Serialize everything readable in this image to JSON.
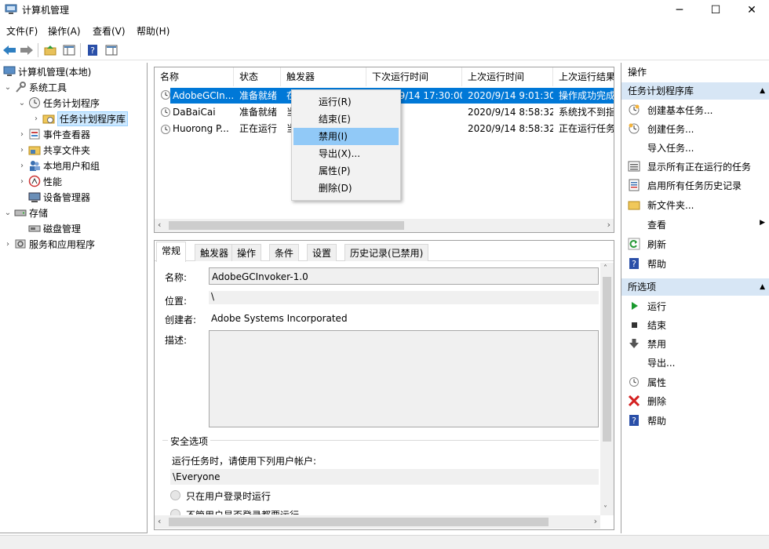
{
  "window": {
    "title": "计算机管理",
    "minimize": "─",
    "maximize": "☐",
    "close": "✕"
  },
  "menu": [
    "文件(F)",
    "操作(A)",
    "查看(V)",
    "帮助(H)"
  ],
  "tree": {
    "root": "计算机管理(本地)",
    "system_tools": "系统工具",
    "task_scheduler": "任务计划程序",
    "task_library": "任务计划程序库",
    "event_viewer": "事件查看器",
    "shared_folders": "共享文件夹",
    "local_users": "本地用户和组",
    "performance": "性能",
    "device_manager": "设备管理器",
    "storage": "存储",
    "disk_management": "磁盘管理",
    "services": "服务和应用程序"
  },
  "grid": {
    "headers": [
      "名称",
      "状态",
      "触发器",
      "下次运行时间",
      "上次运行时间",
      "上次运行结果"
    ],
    "rows": [
      [
        "AdobeGCIn...",
        "准备就绪",
        "在",
        "2020/9/14 17:30:00",
        "2020/9/14 9:01:30",
        "操作成功完成"
      ],
      [
        "DaBaiCai",
        "准备就绪",
        "当",
        "",
        "2020/9/14 8:58:32",
        "系统找不到指"
      ],
      [
        "Huorong P...",
        "正在运行",
        "当",
        "",
        "2020/9/14 8:58:32",
        "正在运行任务"
      ]
    ]
  },
  "context_menu": [
    "运行(R)",
    "结束(E)",
    "禁用(I)",
    "导出(X)...",
    "属性(P)",
    "删除(D)"
  ],
  "details": {
    "tabs": [
      "常规",
      "触发器",
      "操作",
      "条件",
      "设置",
      "历史记录(已禁用)"
    ],
    "name_label": "名称:",
    "name_value": "AdobeGCInvoker-1.0",
    "location_label": "位置:",
    "location_value": "\\",
    "author_label": "创建者:",
    "author_value": "Adobe Systems Incorporated",
    "desc_label": "描述:",
    "security_legend": "安全选项",
    "run_as_label": "运行任务时，请使用下列用户帐户:",
    "run_as_value": "\\Everyone",
    "radio1": "只在用户登录时运行",
    "radio2": "不管用户是否登录都要运行"
  },
  "actions": {
    "header": "操作",
    "section1": "任务计划程序库",
    "items1": [
      "创建基本任务...",
      "创建任务...",
      "导入任务...",
      "显示所有正在运行的任务",
      "启用所有任务历史记录",
      "新文件夹...",
      "查看",
      "刷新",
      "帮助"
    ],
    "section2": "所选项",
    "items2": [
      "运行",
      "结束",
      "禁用",
      "导出...",
      "属性",
      "删除",
      "帮助"
    ]
  },
  "colors": {
    "selection": "#0078d7",
    "context_highlight": "#91c9f7",
    "section_bg": "#d7e6f5"
  }
}
